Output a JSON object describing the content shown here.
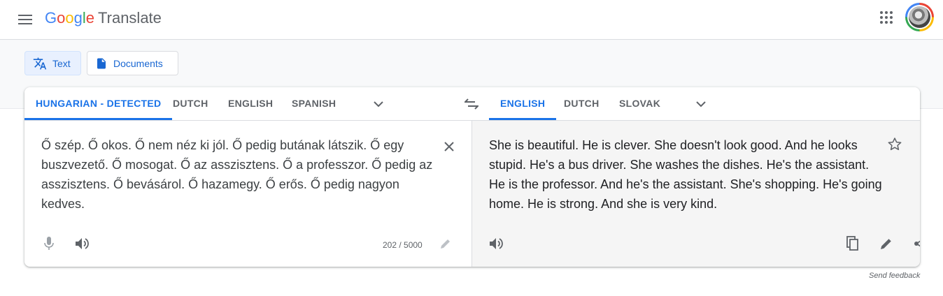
{
  "header": {
    "logo_letters": [
      "G",
      "o",
      "o",
      "g",
      "l",
      "e"
    ],
    "product": "Translate",
    "icons": {
      "menu": "menu-icon",
      "apps": "apps-grid-icon",
      "avatar": "account-avatar"
    }
  },
  "modes": [
    {
      "label": "Text",
      "icon": "translate-icon",
      "active": true
    },
    {
      "label": "Documents",
      "icon": "document-icon",
      "active": false
    }
  ],
  "source_langs": [
    "HUNGARIAN - DETECTED",
    "DUTCH",
    "ENGLISH",
    "SPANISH"
  ],
  "target_langs": [
    "ENGLISH",
    "DUTCH",
    "SLOVAK"
  ],
  "source": {
    "text": "Ő szép. Ő okos. Ő nem néz ki jól. Ő pedig butának látszik. Ő egy buszvezető. Ő mosogat. Ő az asszisztens. Ő a professzor. Ő pedig az asszisztens. Ő bevásárol. Ő hazamegy. Ő erős. Ő pedig nagyon kedves.",
    "char_count": "202 / 5000"
  },
  "target": {
    "text": "She is beautiful. He is clever. She doesn't look good. And he looks stupid. He's a bus driver. She washes the dishes. He's the assistant. He is the professor. And he's the assistant. She's shopping. He's going home. He is strong. And she is very kind."
  },
  "footer": {
    "feedback": "Send feedback"
  },
  "colors": {
    "accent": "#1a73e8",
    "active_tab_bg": "#e8f0fe",
    "target_pane_bg": "#f5f5f5"
  }
}
